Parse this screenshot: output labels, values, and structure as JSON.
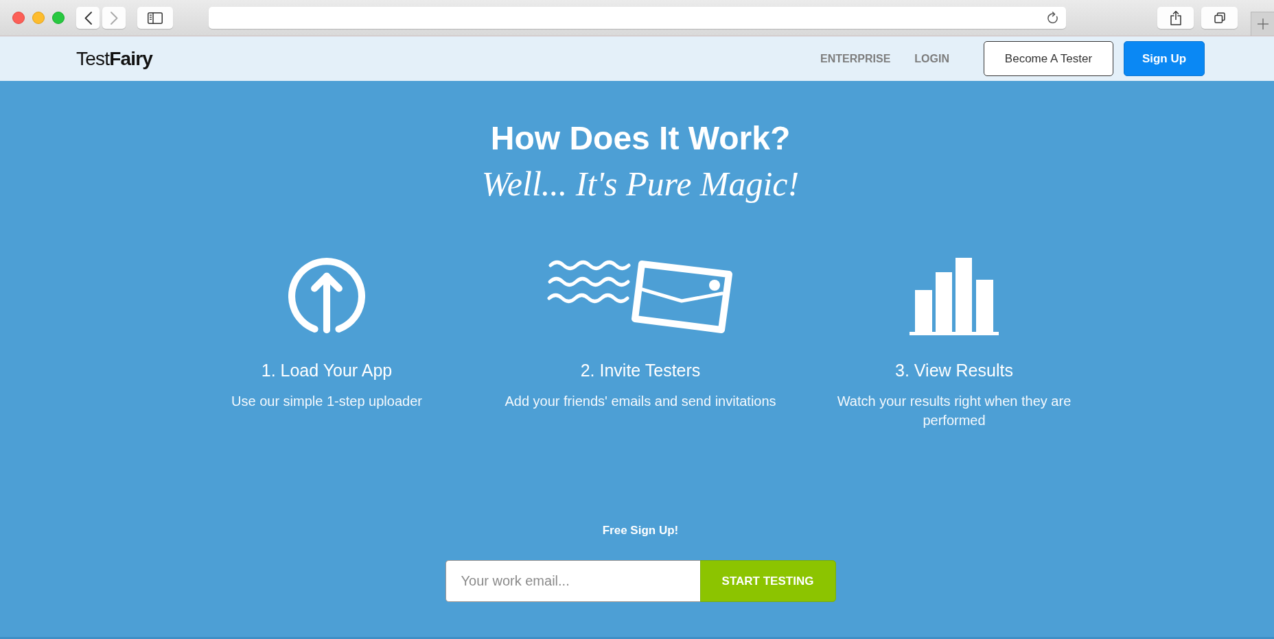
{
  "browser": {
    "back_button": {
      "disabled": false
    },
    "forward_button": {
      "disabled": true
    }
  },
  "header": {
    "logo": "Test**Fairy**",
    "nav_links": [
      {
        "label": "ENTERPRISE"
      },
      {
        "label": "LOGIN"
      }
    ],
    "buttons": [
      {
        "label": "Become A Tester",
        "kind": "outline"
      },
      {
        "label": "Sign Up",
        "kind": "primary"
      }
    ]
  },
  "hero": {
    "title": "How Does It Work?",
    "subtitle": "Well... It's Pure Magic!"
  },
  "steps": [
    {
      "kind": "upload",
      "title": "1. Load Your App",
      "description": "Use our simple 1-step uploader"
    },
    {
      "kind": "invite",
      "title": "2. Invite Testers",
      "description": "Add your friends' emails and send invitations"
    },
    {
      "kind": "results",
      "title": "3. View Results",
      "description": "Watch your results right when they are performed"
    }
  ],
  "signup": {
    "label": "Free Sign Up!",
    "email_field": {
      "placeholder": "Your work email..."
    },
    "button": "START TESTING"
  }
}
